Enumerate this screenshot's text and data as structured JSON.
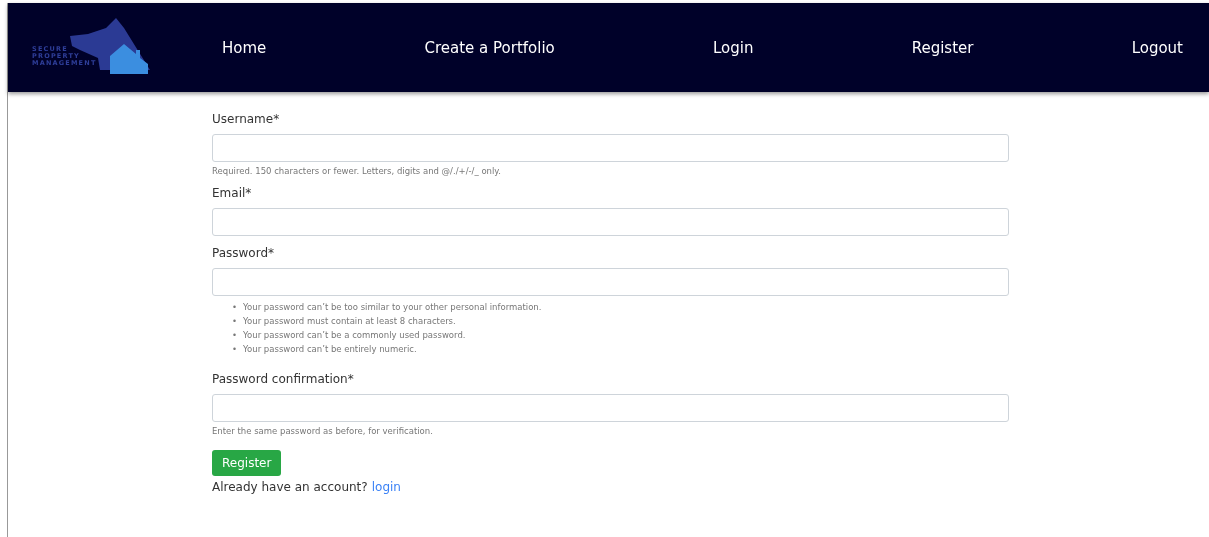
{
  "logo": {
    "lines": [
      "SECURE",
      "PROPERTY",
      "MANAGEMENT"
    ]
  },
  "nav": [
    {
      "label": "Home"
    },
    {
      "label": "Create a Portfolio"
    },
    {
      "label": "Login"
    },
    {
      "label": "Register"
    },
    {
      "label": "Logout"
    }
  ],
  "form": {
    "fields": [
      {
        "label": "Username*",
        "help": "Required. 150 characters or fewer. Letters, digits and @/./+/-/_ only."
      },
      {
        "label": "Email*"
      },
      {
        "label": "Password*",
        "bullet": "•",
        "rules": [
          "Your password can’t be too similar to your other personal information.",
          "Your password must contain at least 8 characters.",
          "Your password can’t be a commonly used password.",
          "Your password can’t be entirely numeric."
        ]
      },
      {
        "label": "Password confirmation*",
        "help": "Enter the same password as before, for verification."
      }
    ],
    "submit": "Register",
    "footer": {
      "text": "Already have an account?",
      "link": "login"
    }
  }
}
